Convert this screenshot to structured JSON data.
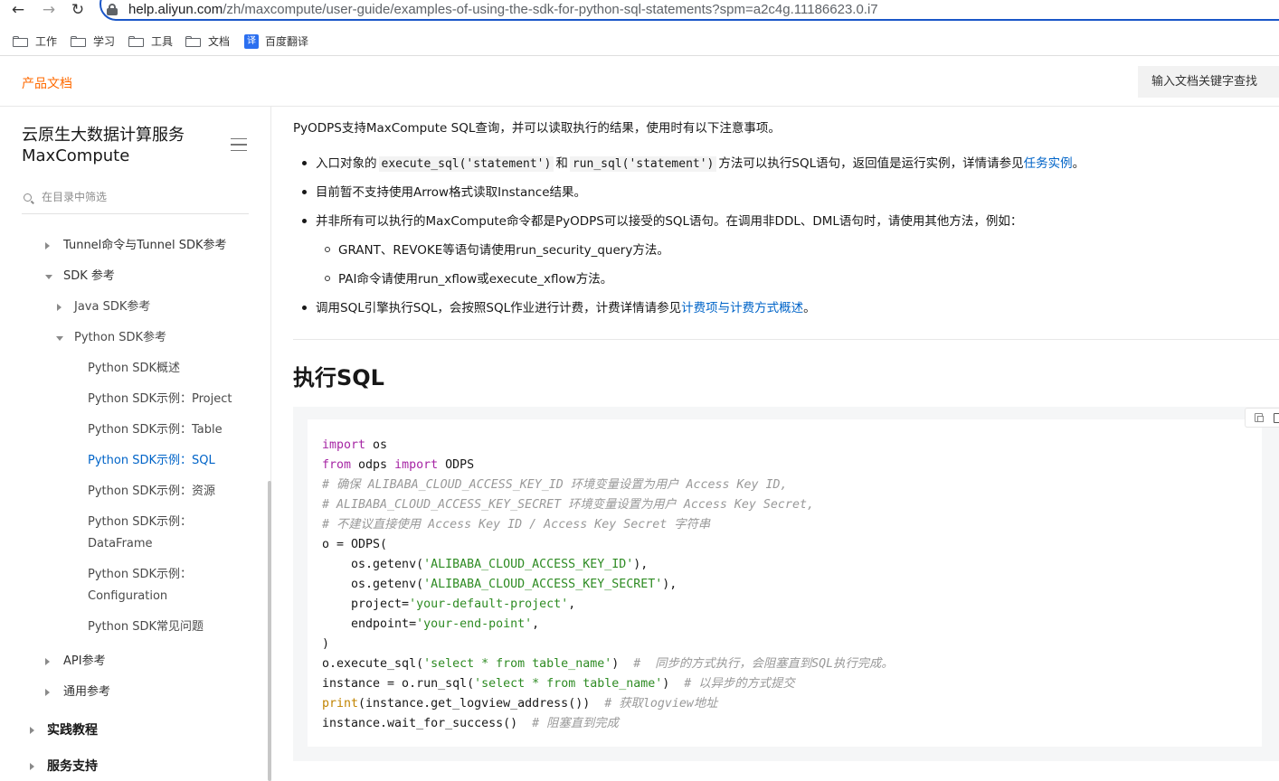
{
  "browser": {
    "url_host": "help.aliyun.com",
    "url_path": "/zh/maxcompute/user-guide/examples-of-using-the-sdk-for-python-sql-statements?spm=a2c4g.11186623.0.i7",
    "bookmarks": [
      "工作",
      "学习",
      "工具",
      "文档"
    ],
    "translate_icon": "译",
    "translate_label": "百度翻译"
  },
  "header": {
    "product_docs": "产品文档",
    "search_label": "输入文档关键字查找"
  },
  "sidebar": {
    "title_line1": "云原生大数据计算服务",
    "title_line2": "MaxCompute",
    "filter_placeholder": "在目录中筛选",
    "items": [
      {
        "label": "Tunnel命令与Tunnel SDK参考"
      },
      {
        "label": "SDK 参考"
      },
      {
        "label": "Java SDK参考"
      },
      {
        "label": "Python SDK参考"
      },
      {
        "label": "Python SDK概述"
      },
      {
        "label": "Python SDK示例：Project"
      },
      {
        "label": "Python SDK示例：Table"
      },
      {
        "label": "Python SDK示例：SQL"
      },
      {
        "label": "Python SDK示例：资源"
      },
      {
        "label": "Python SDK示例："
      },
      {
        "label": "DataFrame"
      },
      {
        "label": "Python SDK示例："
      },
      {
        "label": "Configuration"
      },
      {
        "label": "Python SDK常见问题"
      },
      {
        "label": "API参考"
      },
      {
        "label": "通用参考"
      },
      {
        "label": "实践教程"
      },
      {
        "label": "服务支持"
      }
    ]
  },
  "content": {
    "intro": "PyODPS支持MaxCompute SQL查询，并可以读取执行的结果，使用时有以下注意事项。",
    "b1_pre": "入口对象的",
    "b1_code1": "execute_sql('statement')",
    "b1_mid": "和",
    "b1_code2": "run_sql('statement')",
    "b1_post": "方法可以执行SQL语句，返回值是运行实例，详情请参见",
    "b1_link": "任务实例",
    "b1_end": "。",
    "b2": "目前暂不支持使用Arrow格式读取Instance结果。",
    "b3": "并非所有可以执行的MaxCompute命令都是PyODPS可以接受的SQL语句。在调用非DDL、DML语句时，请使用其他方法，例如：",
    "b3_sub1": "GRANT、REVOKE等语句请使用run_security_query方法。",
    "b3_sub2": "PAI命令请使用run_xflow或execute_xflow方法。",
    "b4_pre": "调用SQL引擎执行SQL，会按照SQL作业进行计费，计费详情请参见",
    "b4_link": "计费项与计费方式概述",
    "b4_end": "。",
    "heading": "执行SQL"
  },
  "code_lines": [
    [
      [
        "kw",
        "import"
      ],
      [
        "",
        " os"
      ]
    ],
    [
      [
        "kw",
        "from"
      ],
      [
        "",
        " odps "
      ],
      [
        "kw",
        "import"
      ],
      [
        "",
        " ODPS"
      ]
    ],
    [
      [
        "cmt",
        "# 确保 ALIBABA_CLOUD_ACCESS_KEY_ID 环境变量设置为用户 Access Key ID,"
      ]
    ],
    [
      [
        "cmt",
        "# ALIBABA_CLOUD_ACCESS_KEY_SECRET 环境变量设置为用户 Access Key Secret,"
      ]
    ],
    [
      [
        "cmt",
        "# 不建议直接使用 Access Key ID / Access Key Secret 字符串"
      ]
    ],
    [
      [
        "",
        "o = ODPS("
      ]
    ],
    [
      [
        "",
        "    os.getenv("
      ],
      [
        "str",
        "'ALIBABA_CLOUD_ACCESS_KEY_ID'"
      ],
      [
        "",
        "),"
      ]
    ],
    [
      [
        "",
        "    os.getenv("
      ],
      [
        "str",
        "'ALIBABA_CLOUD_ACCESS_KEY_SECRET'"
      ],
      [
        "",
        "),"
      ]
    ],
    [
      [
        "",
        "    project="
      ],
      [
        "str",
        "'your-default-project'"
      ],
      [
        "",
        ","
      ]
    ],
    [
      [
        "",
        "    endpoint="
      ],
      [
        "str",
        "'your-end-point'"
      ],
      [
        "",
        ","
      ]
    ],
    [
      [
        "",
        ")"
      ]
    ],
    [
      [
        "",
        "o.execute_sql("
      ],
      [
        "str",
        "'select * from table_name'"
      ],
      [
        "",
        ")  "
      ],
      [
        "cmt",
        "#  同步的方式执行，会阻塞直到SQL执行完成。"
      ]
    ],
    [
      [
        "",
        "instance = o.run_sql("
      ],
      [
        "str",
        "'select * from table_name'"
      ],
      [
        "",
        ")  "
      ],
      [
        "cmt",
        "# 以异步的方式提交"
      ]
    ],
    [
      [
        "fn",
        "print"
      ],
      [
        "",
        "(instance.get_logview_address())  "
      ],
      [
        "cmt",
        "# 获取logview地址"
      ]
    ],
    [
      [
        "",
        "instance.wait_for_success()  "
      ],
      [
        "cmt",
        "# 阻塞直到完成"
      ]
    ]
  ]
}
